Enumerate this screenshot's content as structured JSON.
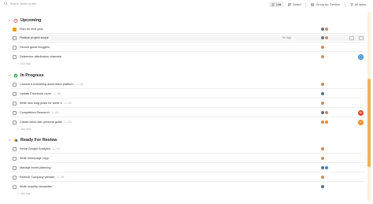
{
  "search": {
    "placeholder": "Search Tasks by title..."
  },
  "toolbar": {
    "list_label": "List",
    "board_label": "Board",
    "group_by_label": "Group by: Section",
    "all_tasks_label": "All tasks"
  },
  "sections": [
    {
      "title": "Upcoming",
      "emoji": "⏰",
      "add_label": "Add task",
      "tasks": [
        {
          "label": "Plan for next year",
          "sub": ""
        },
        {
          "label": "Finalize project scope",
          "sub": "",
          "tag": "No tags"
        },
        {
          "label": "Recruit guest bloggers",
          "sub": ""
        },
        {
          "label": "Determine distribution channels",
          "sub": ""
        }
      ]
    },
    {
      "title": "In Progress",
      "emoji": "●",
      "add_label": "Add task",
      "tasks": [
        {
          "label": "Choose a marketing automation platform",
          "sub": "1/2"
        },
        {
          "label": "Update Facebook cover",
          "sub": "0/2"
        },
        {
          "label": "Write new blog posts for week 4",
          "sub": "0/3"
        },
        {
          "label": "Competitors Research",
          "sub": "0/1"
        },
        {
          "label": "Create ideal user persona guide",
          "sub": "0/1"
        }
      ]
    },
    {
      "title": "Ready For Review",
      "emoji": "🎭",
      "add_label": "Add task",
      "tasks": [
        {
          "label": "Setup Google Analytics",
          "sub": "1/2"
        },
        {
          "label": "Write homepage copy",
          "sub": ""
        },
        {
          "label": "Manage event planning",
          "sub": ""
        },
        {
          "label": "Refresh Company website",
          "sub": "0/4"
        },
        {
          "label": "Write monthly newsletter",
          "sub": ""
        }
      ]
    }
  ],
  "colors": {
    "accent": "#f3b24a",
    "avatar_a": "#c98a5e",
    "avatar_b": "#5a6f8a",
    "badge_blue": "#2e8bd6",
    "badge_red": "#d9482b",
    "badge_orange": "#f08a24"
  },
  "badges": {
    "r1": "R",
    "r2": "C"
  }
}
